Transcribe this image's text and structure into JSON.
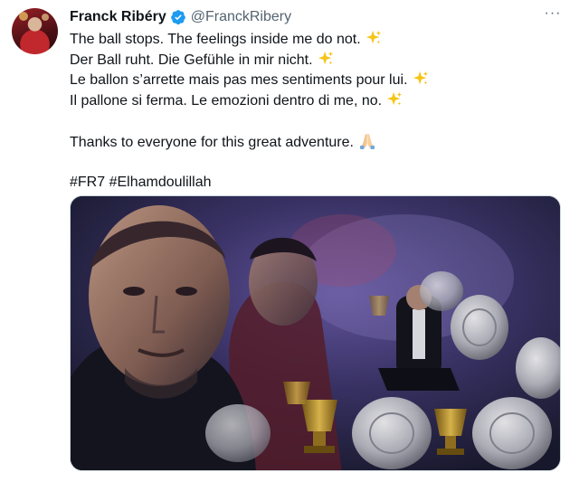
{
  "author": {
    "name": "Franck Ribéry",
    "handle": "@FranckRibery",
    "verified": true
  },
  "menu": {
    "more_label": "···"
  },
  "tweet": {
    "lines": [
      "The ball stops. The feelings inside me do not.",
      "Der Ball ruht. Die Gefühle in mir nicht.",
      "Le ballon s’arrette mais pas mes sentiments pour lui.",
      "Il pallone si ferma. Le emozioni dentro di me, no."
    ],
    "thanks": "Thanks to everyone for this great adventure.",
    "hashtags": "#FR7 #Elhamdoulillah"
  },
  "colors": {
    "verified_badge": "#1d9bf0",
    "handle": "#536471",
    "sparkle": "#f5c518"
  },
  "icons": [
    "verified-icon",
    "more-icon",
    "sparkles-icon",
    "folded-hands-icon"
  ]
}
